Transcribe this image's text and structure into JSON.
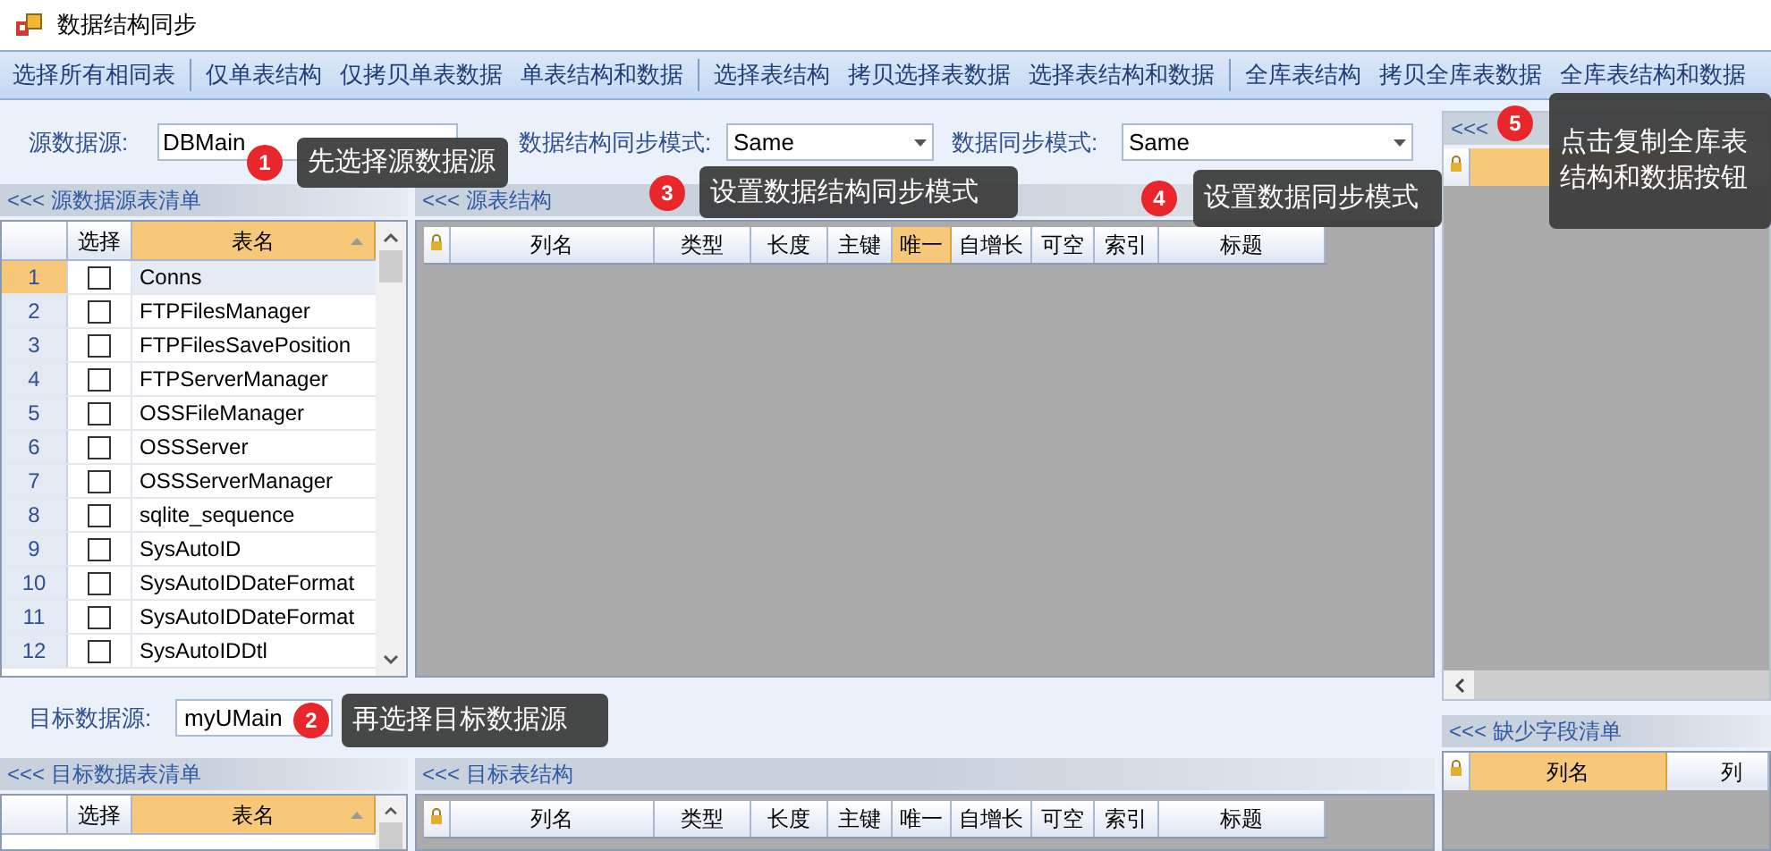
{
  "window": {
    "title": "数据结构同步"
  },
  "toolbar_groups": [
    {
      "buttons": [
        "选择所有相同表"
      ]
    },
    {
      "buttons": [
        "仅单表结构",
        "仅拷贝单表数据",
        "单表结构和数据"
      ]
    },
    {
      "buttons": [
        "选择表结构",
        "拷贝选择表数据",
        "选择表结构和数据"
      ]
    },
    {
      "buttons": [
        "全库表结构",
        "拷贝全库表数据",
        "全库表结构和数据"
      ]
    }
  ],
  "source": {
    "label": "源数据源:",
    "value": "DBMain"
  },
  "structure_mode": {
    "label": "数据结构同步模式:",
    "value": "Same"
  },
  "data_mode": {
    "label": "数据同步模式:",
    "value": "Same"
  },
  "source_tables": {
    "title": "<<< 源数据源表清单",
    "columns": [
      {
        "label": "选择",
        "selected": false
      },
      {
        "label": "表名",
        "selected": true
      }
    ],
    "rows": [
      {
        "number": "1",
        "checked": false,
        "name": "Conns",
        "selected": true
      },
      {
        "number": "2",
        "checked": false,
        "name": "FTPFilesManager",
        "selected": false
      },
      {
        "number": "3",
        "checked": false,
        "name": "FTPFilesSavePosition",
        "selected": false
      },
      {
        "number": "4",
        "checked": false,
        "name": "FTPServerManager",
        "selected": false
      },
      {
        "number": "5",
        "checked": false,
        "name": "OSSFileManager",
        "selected": false
      },
      {
        "number": "6",
        "checked": false,
        "name": "OSSServer",
        "selected": false
      },
      {
        "number": "7",
        "checked": false,
        "name": "OSSServerManager",
        "selected": false
      },
      {
        "number": "8",
        "checked": false,
        "name": "sqlite_sequence",
        "selected": false
      },
      {
        "number": "9",
        "checked": false,
        "name": "SysAutoID",
        "selected": false
      },
      {
        "number": "10",
        "checked": false,
        "name": "SysAutoIDDateFormat",
        "selected": false
      },
      {
        "number": "11",
        "checked": false,
        "name": "SysAutoIDDateFormat",
        "selected": false
      },
      {
        "number": "12",
        "checked": false,
        "name": "SysAutoIDDtl",
        "selected": false
      }
    ]
  },
  "source_structure": {
    "title": "<<< 源表结构",
    "columns": [
      {
        "label": "列名",
        "selected": false
      },
      {
        "label": "类型",
        "selected": false
      },
      {
        "label": "长度",
        "selected": false
      },
      {
        "label": "主键",
        "selected": false
      },
      {
        "label": "唯一",
        "selected": true
      },
      {
        "label": "自增长",
        "selected": false
      },
      {
        "label": "可空",
        "selected": false
      },
      {
        "label": "索引",
        "selected": false
      },
      {
        "label": "标题",
        "selected": false
      }
    ]
  },
  "diff_panel": {
    "title": "<<<"
  },
  "target": {
    "label": "目标数据源:",
    "value": "myUMain"
  },
  "target_tables": {
    "title": "<<< 目标数据表清单",
    "columns": [
      {
        "label": "选择",
        "selected": false
      },
      {
        "label": "表名",
        "selected": true
      }
    ]
  },
  "target_structure": {
    "title": "<<< 目标表结构",
    "columns": [
      {
        "label": "列名",
        "selected": false
      },
      {
        "label": "类型",
        "selected": false
      },
      {
        "label": "长度",
        "selected": false
      },
      {
        "label": "主键",
        "selected": false
      },
      {
        "label": "唯一",
        "selected": false
      },
      {
        "label": "自增长",
        "selected": false
      },
      {
        "label": "可空",
        "selected": false
      },
      {
        "label": "索引",
        "selected": false
      },
      {
        "label": "标题",
        "selected": false
      }
    ]
  },
  "missing_fields": {
    "title": "<<< 缺少字段清单",
    "columns": [
      {
        "label": "列名",
        "selected": true
      },
      {
        "label": "列",
        "selected": false
      }
    ]
  },
  "callouts": [
    {
      "number": "1",
      "text": "先选择源数据源"
    },
    {
      "number": "2",
      "text": "再选择目标数据源"
    },
    {
      "number": "3",
      "text": "设置数据结构同步模式"
    },
    {
      "number": "4",
      "text": "设置数据同步模式"
    },
    {
      "number": "5",
      "text": "点击复制全库表结构和数据按钮"
    }
  ]
}
